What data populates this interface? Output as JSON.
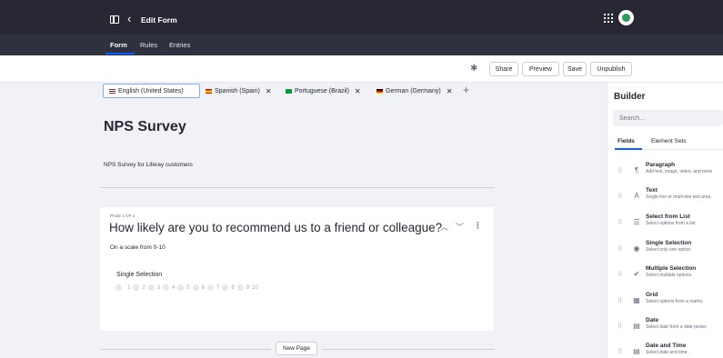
{
  "header": {
    "title": "Edit Form",
    "tabs": [
      "Form",
      "Rules",
      "Entries"
    ]
  },
  "toolbar": {
    "share": "Share",
    "preview": "Preview",
    "save": "Save",
    "unpublish": "Unpublish"
  },
  "languages": [
    {
      "label": "English (United States)",
      "flag_color": "#3c3b6e"
    },
    {
      "label": "Spanish (Spain)",
      "flag_color": "#f1bf00"
    },
    {
      "label": "Portuguese (Brazil)",
      "flag_color": "#009c3b"
    },
    {
      "label": "German (Germany)",
      "flag_color": "#dd0000"
    }
  ],
  "form": {
    "title": "NPS Survey",
    "description": "NPS Survey for Liferay customers",
    "page_label": "PAGE 1 OF 2",
    "question": "How likely are you to recommend us to a friend or colleague?",
    "question_desc": "On a scale from 0-10",
    "field_label": "Single Selection",
    "scale": [
      "",
      "1",
      "2",
      "3",
      "4",
      "5",
      "6",
      "7",
      "8",
      "9",
      "10"
    ],
    "new_page": "New Page"
  },
  "builder": {
    "title": "Builder",
    "search_placeholder": "Search...",
    "tabs": [
      "Fields",
      "Element Sets"
    ],
    "fields": [
      {
        "name": "Paragraph",
        "desc": "Add text, image, video, and more"
      },
      {
        "name": "Text",
        "desc": "Single line or multi-line text area."
      },
      {
        "name": "Select from List",
        "desc": "Select options from a list."
      },
      {
        "name": "Single Selection",
        "desc": "Select only one option."
      },
      {
        "name": "Multiple Selection",
        "desc": "Select multiple options."
      },
      {
        "name": "Grid",
        "desc": "Select options from a matrix."
      },
      {
        "name": "Date",
        "desc": "Select date from a date picker."
      },
      {
        "name": "Date and Time",
        "desc": "Select date and time."
      }
    ]
  }
}
